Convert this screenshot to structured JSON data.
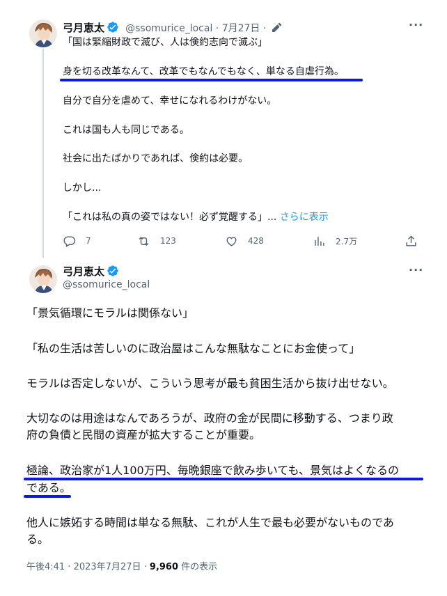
{
  "parent_tweet": {
    "author_name": "弓月恵太",
    "handle_meta": "@ssomurice_local · 7月27日 ·",
    "lines": [
      "「国は緊縮財政で滅び、人は倹約志向で滅ぶ」",
      "身を切る改革なんて、改革でもなんでもなく、単なる自虐行為。",
      "自分で自分を虐めて、幸せになれるわけがない。",
      "これは国も人も同じである。",
      "社会に出たばかりであれば、倹約は必要。",
      "しかし...",
      "「これは私の真の姿ではない！必ず覚醒する」..."
    ],
    "show_more": "さらに表示",
    "actions": {
      "replies": "7",
      "retweets": "123",
      "likes": "428",
      "views": "2.7万"
    }
  },
  "main_tweet": {
    "author_name": "弓月恵太",
    "handle": "@ssomurice_local",
    "lines": [
      "「景気循環にモラルは関係ない」",
      "「私の生活は苦しいのに政治屋はこんな無駄なことにお金使って」",
      "モラルは否定しないが、こういう思考が最も貧困生活から抜け出せない。",
      "大切なのは用途はなんであろうが、政府の金が民間に移動する、つまり政",
      "府の負債と民間の資産が拡大することが重要。",
      "極論、政治家が1人100万円、毎晩銀座で飲み歩いても、景気はよくなるの",
      "である。",
      "他人に嫉妬する時間は単なる無駄、これが人生で最も必要がないものであ",
      "る。"
    ],
    "footer": {
      "timestamp": "午後4:41 · 2023年7月27日 ·",
      "views_count": "9,960",
      "views_label": "件の表示"
    }
  },
  "colors": {
    "accent_blue": "#1d9bf0",
    "annotation_underline": "#0a1bd9",
    "secondary_text": "#536471"
  }
}
